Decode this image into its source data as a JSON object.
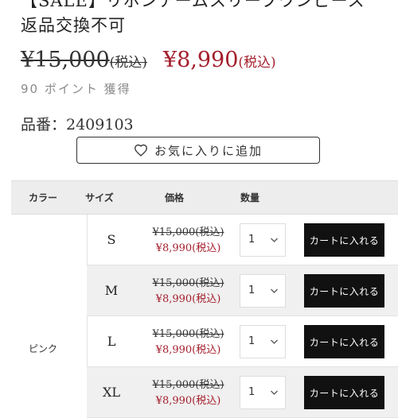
{
  "product": {
    "title": "【SALE】リボンアームスリーブワンピース 返品交換不可",
    "original_price": "¥15,000",
    "original_tax": "(税込)",
    "sale_price": "¥8,990",
    "sale_tax": "(税込)",
    "points": "90 ポイント 獲得",
    "sku": "品番：2409103"
  },
  "favorite_button": {
    "label": "お気に入りに追加",
    "icon": "heart-outline-icon"
  },
  "table": {
    "headers": {
      "color": "カラー",
      "size": "サイズ",
      "price": "価格",
      "quantity": "数量"
    },
    "color": "ピンク",
    "rows": [
      {
        "size": "S",
        "original_price": "¥15,000(税込)",
        "sale_price": "¥8,990(税込)",
        "quantity": "1",
        "cart_label": "カートに入れる"
      },
      {
        "size": "M",
        "original_price": "¥15,000(税込)",
        "sale_price": "¥8,990(税込)",
        "quantity": "1",
        "cart_label": "カートに入れる"
      },
      {
        "size": "L",
        "original_price": "¥15,000(税込)",
        "sale_price": "¥8,990(税込)",
        "quantity": "1",
        "cart_label": "カートに入れる"
      },
      {
        "size": "XL",
        "original_price": "¥15,000(税込)",
        "sale_price": "¥8,990(税込)",
        "quantity": "1",
        "cart_label": "カートに入れる"
      }
    ]
  },
  "colors": {
    "sale_red": "#a41e2c",
    "button_black": "#111111",
    "header_gray": "#ededed"
  }
}
